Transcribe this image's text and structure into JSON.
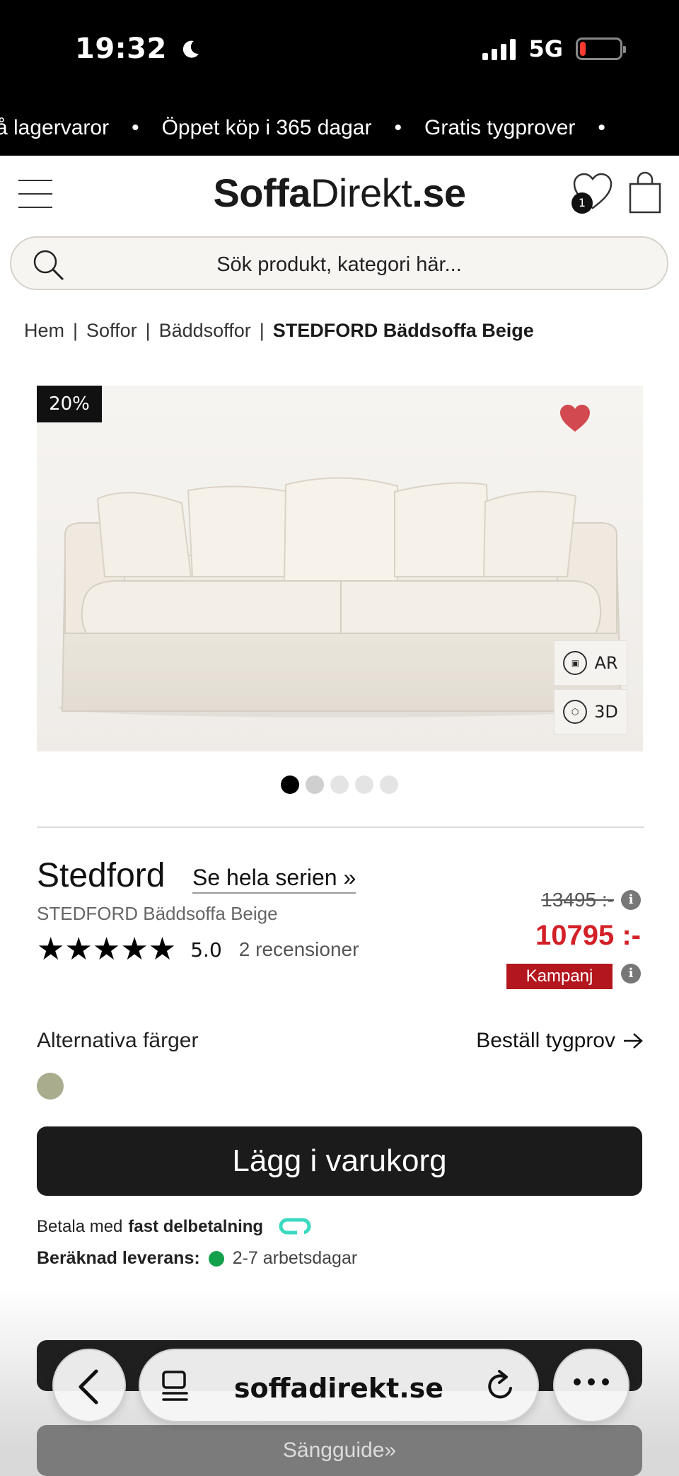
{
  "status_bar": {
    "time": "19:32",
    "network": "5G",
    "battery_level": 0.15
  },
  "ticker": {
    "items": [
      "å lagervaror",
      "Öppet köp i 365 dagar",
      "Gratis tygprover"
    ],
    "separator": "•"
  },
  "header": {
    "logo_part1": "Soffa",
    "logo_part2": "Direkt",
    "logo_part3": ".se",
    "wishlist_count": "1"
  },
  "search": {
    "placeholder": "Sök produkt, kategori här..."
  },
  "breadcrumb": [
    "Hem",
    "Soffor",
    "Bäddsoffor",
    "STEDFORD Bäddsoffa Beige"
  ],
  "breadcrumb_separator": "|",
  "gallery": {
    "discount_badge": "20%",
    "ar_label": "AR",
    "view3d_label": "3D",
    "image_count": 5,
    "active_index": 0
  },
  "product": {
    "name": "Stedford",
    "series_link": "Se hela serien »",
    "subtitle": "STEDFORD Bäddsoffa Beige",
    "stars": "★★★★★",
    "rating": "5.0",
    "reviews": "2 recensioner",
    "old_price": "13495 :-",
    "price": "10795 :-",
    "campaign_label": "Kampanj",
    "price_color": "#d32027",
    "campaign_color": "#b4161e"
  },
  "options": {
    "alt_colors_label": "Alternativa färger",
    "order_sample_label": "Beställ tygprov",
    "swatch_color": "#a9ad8d"
  },
  "actions": {
    "add_to_cart": "Lägg i varukorg",
    "pay_prefix": "Betala med",
    "pay_bold": "fast delbetalning",
    "delivery_label": "Beräknad leverans:",
    "delivery_time": "2-7 arbetsdagar",
    "bed_guide": "Sängguide»"
  },
  "browser": {
    "url": "soffadirekt.se"
  }
}
